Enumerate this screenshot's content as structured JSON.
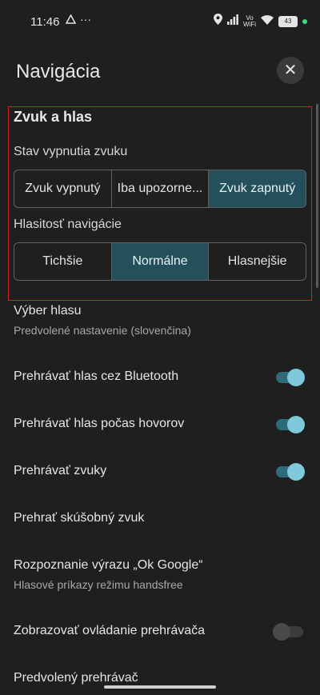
{
  "status": {
    "time": "11:46",
    "vowifi_top": "Vo",
    "vowifi_bottom": "WiFi",
    "battery": "43",
    "icons": [
      "cast-icon",
      "more-dots-icon",
      "location-icon",
      "signal-icon",
      "wifi-icon",
      "battery-icon"
    ]
  },
  "header": {
    "title": "Navigácia",
    "close_label": "✕"
  },
  "sound_section": {
    "title": "Zvuk a hlas",
    "mute_label": "Stav vypnutia zvuku",
    "mute_options": [
      "Zvuk vypnutý",
      "Iba upozorne...",
      "Zvuk zapnutý"
    ],
    "mute_selected": "Zvuk zapnutý",
    "volume_label": "Hlasitosť navigácie",
    "volume_options": [
      "Tichšie",
      "Normálne",
      "Hlasnejšie"
    ],
    "volume_selected": "Normálne"
  },
  "settings": {
    "voice_title": "Výber hlasu",
    "voice_sub": "Predvolené nastavenie (slovenčina)",
    "bluetooth_title": "Prehrávať hlas cez Bluetooth",
    "bluetooth_on": true,
    "calls_title": "Prehrávať hlas počas hovorov",
    "calls_on": true,
    "sounds_title": "Prehrávať zvuky",
    "sounds_on": true,
    "test_title": "Prehrať skúšobný zvuk",
    "okgoogle_title": "Rozpoznanie výrazu „Ok Google“",
    "okgoogle_sub": "Hlasové príkazy režimu handsfree",
    "player_title": "Zobrazovať ovládanie prehrávača",
    "player_on": false,
    "default_player_title": "Predvolený prehrávač"
  },
  "colors": {
    "accent": "#23505b",
    "toggle_on": "#7fc9da",
    "highlight_border": "#c62828"
  }
}
